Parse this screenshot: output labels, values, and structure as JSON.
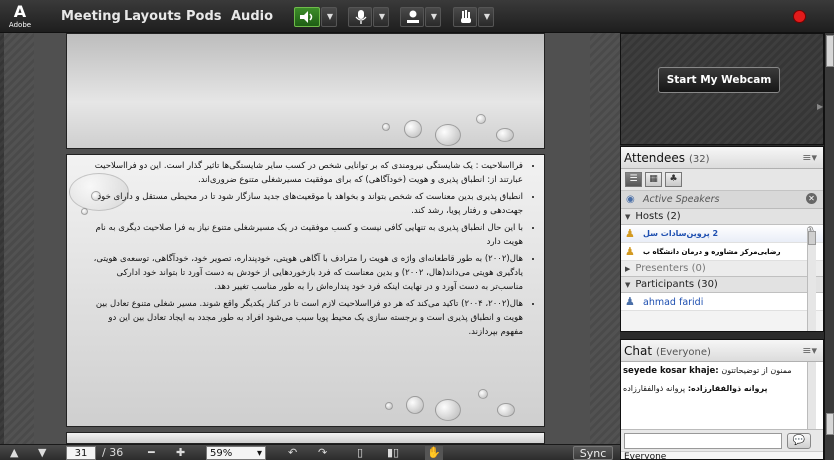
{
  "topbar": {
    "logo_mark": "A",
    "logo_word": "Adobe",
    "menus": [
      "Meeting",
      "Layouts",
      "Pods",
      "Audio"
    ],
    "icons": [
      "speaker-icon",
      "microphone-icon",
      "user-icon",
      "raise-hand-icon"
    ],
    "record_status_color": "#e21b1b"
  },
  "slide": {
    "bullets": [
      "فرااسلاحیت : یک شایستگی نیرومندی که بر توانایی شخص در کسب سایر شایستگی‌ها تاثیر گذار است. این دو فرااسلاحیت عبارتند از: انطباق پذیری و هویت (خودآگاهی) که برای موفقیت مسیرشغلی متنوع ضروری‌اند.",
      "انطباق پذیری بدین معناست که شخص بتواند و بخواهد با موقعیت‌های جدید سازگار شود تا در محیطی مستقل و دارای خود جهت‌دهی و رفتار پویا، رشد کند.",
      "با این حال انطباق پذیری به تنهایی کافی نیست و کسب موفقیت در یک مسیرشغلی متنوع نیاز به فرا صلاحیت دیگری به نام هویت دارد",
      "هال(۲۰۰۲) به طور قاطعانه‌ای واژه ی هویت را مترادف با آگاهی هویتی، خودپنداره، تصویر خود، خودآگاهی، توسعه‌ی هویتی، یادگیری هویتی می‌داند(هال، ۲۰۰۲) و بدین معناست که فرد بازخوردهایی از خودش به دست آورد تا بتواند خود ادارکی مناسب‌تر به دست آورد و در نهایت اینکه فرد خود پنداره‌اش را به طور مناسب تغییر دهد.",
      "هال(۲۰۰۲، ۲۰۰۴) تاکید می‌کند که هر دو فرااسلاحیت لازم است تا در کنار یکدیگر واقع شوند. مسیر شغلی متنوع تعادل بین هویت و انطباق پذیری است و برجسته سازی یک محیط پویا سبب می‌شود افراد به طور مجدد به ایجاد تعادل  بین این دو مفهوم بپردازند."
    ]
  },
  "bottombar": {
    "current_page": "31",
    "total_pages": "/ 36",
    "zoom": "59%",
    "sync_label": "Sync"
  },
  "webcam": {
    "button_label": "Start My Webcam"
  },
  "attendees": {
    "title": "Attendees",
    "count": "(32)",
    "active_speakers_label": "Active Speakers",
    "hosts_label": "Hosts (2)",
    "hosts": [
      {
        "name": "2 پروین‌سادات سل"
      },
      {
        "name": "رضایی‌مرکز مشاوره و درمان دانشگاه ب"
      }
    ],
    "presenters_label": "Presenters (0)",
    "participants_label": "Participants (30)",
    "participants": [
      {
        "name": "ahmad faridi"
      }
    ]
  },
  "chat": {
    "title": "Chat",
    "scope": "(Everyone)",
    "messages": [
      {
        "sender": "seyede kosar khaje:",
        "text": "ممنون از توضیحاتتون"
      },
      {
        "sender": "پروانه ذوالفقارزاده:",
        "text": "پروانه ذوالفقارزاده"
      }
    ],
    "recipient": "Everyone"
  }
}
